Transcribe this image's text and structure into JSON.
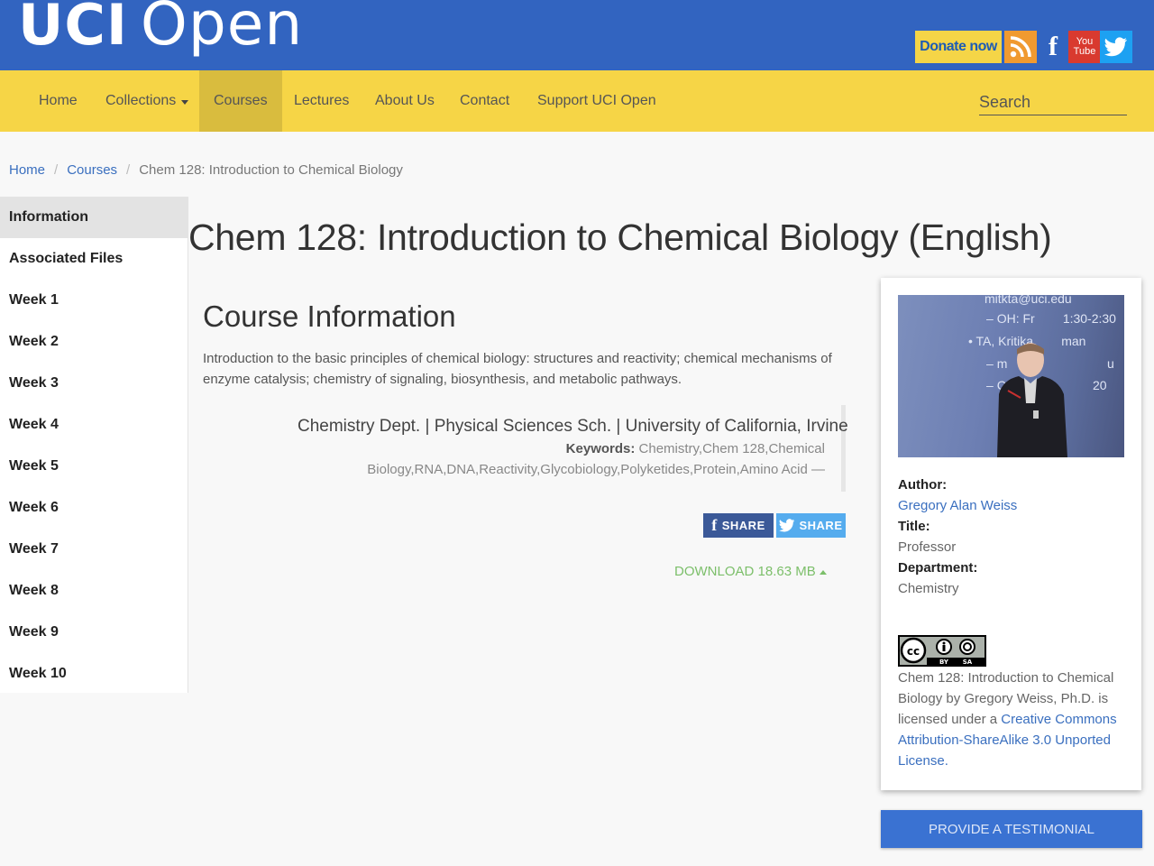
{
  "header": {
    "logo_bold": "UCI",
    "logo_light": "Open",
    "donate_label": "Donate now",
    "youtube_label": "You Tube"
  },
  "nav": {
    "items": [
      {
        "label": "Home"
      },
      {
        "label": "Collections"
      },
      {
        "label": "Courses",
        "active": true
      },
      {
        "label": "Lectures"
      },
      {
        "label": "About Us"
      },
      {
        "label": "Contact"
      },
      {
        "label": "Support UCI Open"
      }
    ],
    "search_placeholder": "Search"
  },
  "breadcrumb": {
    "home": "Home",
    "courses": "Courses",
    "current": "Chem 128: Introduction to Chemical Biology"
  },
  "sidebar": {
    "items": [
      {
        "label": "Information",
        "active": true
      },
      {
        "label": "Associated Files"
      },
      {
        "label": "Week 1"
      },
      {
        "label": "Week 2"
      },
      {
        "label": "Week 3"
      },
      {
        "label": "Week 4"
      },
      {
        "label": "Week 5"
      },
      {
        "label": "Week 6"
      },
      {
        "label": "Week 7"
      },
      {
        "label": "Week 8"
      },
      {
        "label": "Week 9"
      },
      {
        "label": "Week 10"
      }
    ]
  },
  "main": {
    "title": "Chem 128: Introduction to Chemical Biology (English)",
    "section_title": "Course Information",
    "description": "Introduction to the basic principles of chemical biology: structures and reactivity; chemical mechanisms of enzyme catalysis; chemistry of signaling, biosynthesis, and metabolic pathways.",
    "dept_line": "Chemistry Dept. | Physical Sciences Sch. | University of California, Irvine",
    "keywords_label": "Keywords:",
    "keywords_value": "Chemistry,Chem 128,Chemical Biology,RNA,DNA,Reactivity,Glycobiology,Polyketides,Protein,Amino Acid —",
    "share_facebook": "SHARE",
    "share_twitter": "SHARE",
    "download_label": "DOWNLOAD 18.63 MB"
  },
  "card": {
    "photo_lines": [
      "mitkta@uci.edu",
      "OH: Fr",
      "1:30-2:30",
      "• TA, Kritika",
      "man",
      "m",
      "u",
      "C",
      "20"
    ],
    "author_label": "Author:",
    "author_name": "Gregory Alan Weiss",
    "title_label": "Title:",
    "title_value": "Professor",
    "department_label": "Department:",
    "department_value": "Chemistry",
    "cc_letters": "cc",
    "cc_by": "BY",
    "cc_sa": "SA",
    "license_text": "Chem 128: Introduction to Chemical Biology by Gregory Weiss, Ph.D. is licensed under a",
    "license_link": "Creative Commons Attribution-ShareAlike 3.0 Unported License."
  },
  "testimonial_label": "PROVIDE A TESTIMONIAL",
  "colors": {
    "header_blue": "#3264c0",
    "nav_yellow": "#f6d546",
    "link_blue": "#3a6fbf",
    "download_green": "#7cbf6a",
    "button_blue": "#3a72d2"
  }
}
